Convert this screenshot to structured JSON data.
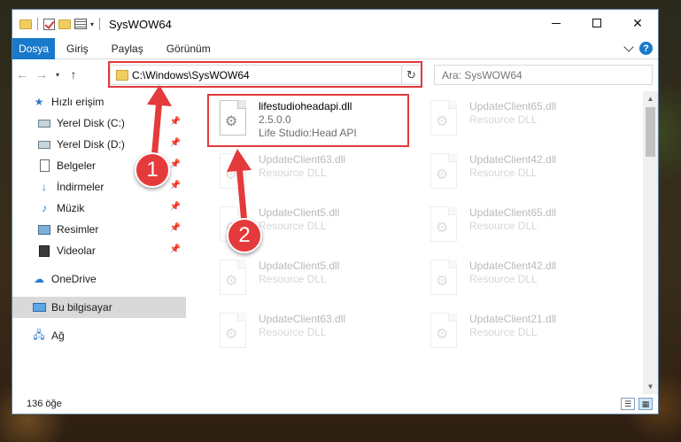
{
  "window": {
    "title": "SysWOW64"
  },
  "ribbon": {
    "tabs": [
      "Dosya",
      "Giriş",
      "Paylaş",
      "Görünüm"
    ]
  },
  "address": {
    "path": "C:\\Windows\\SysWOW64"
  },
  "search": {
    "placeholder": "Ara: SysWOW64"
  },
  "sidebar": {
    "quick_access": "Hızlı erişim",
    "items": [
      {
        "label": "Yerel Disk (C:)",
        "icon": "drive-icon"
      },
      {
        "label": "Yerel Disk (D:)",
        "icon": "drive-icon"
      },
      {
        "label": "Belgeler",
        "icon": "documents-icon"
      },
      {
        "label": "İndirmeler",
        "icon": "download-icon"
      },
      {
        "label": "Müzik",
        "icon": "music-icon"
      },
      {
        "label": "Resimler",
        "icon": "pictures-icon"
      },
      {
        "label": "Videolar",
        "icon": "videos-icon"
      }
    ],
    "onedrive": "OneDrive",
    "this_pc": "Bu bilgisayar",
    "network": "Ağ"
  },
  "files": [
    {
      "name": "lifestudioheadapi.dll",
      "line2": "2.5.0.0",
      "line3": "Life Studio:Head API"
    },
    {
      "name": "UpdateClient65.dll",
      "line2": "Resource DLL"
    },
    {
      "name": "UpdateClient63.dll",
      "line2": "Resource DLL"
    },
    {
      "name": "UpdateClient42.dll",
      "line2": "Resource DLL"
    },
    {
      "name": "UpdateClient5.dll",
      "line2": "Resource DLL"
    },
    {
      "name": "UpdateClient65.dll",
      "line2": "Resource DLL"
    },
    {
      "name": "UpdateClient5.dll",
      "line2": "Resource DLL"
    },
    {
      "name": "UpdateClient42.dll",
      "line2": "Resource DLL"
    },
    {
      "name": "UpdateClient63.dll",
      "line2": "Resource DLL"
    },
    {
      "name": "UpdateClient21.dll",
      "line2": "Resource DLL"
    }
  ],
  "status": {
    "count": "136 öğe"
  },
  "annotations": {
    "step1": "1",
    "step2": "2"
  },
  "colors": {
    "accent": "#1979ca",
    "highlight": "#e03a3c",
    "selection": "#cce8ff"
  }
}
